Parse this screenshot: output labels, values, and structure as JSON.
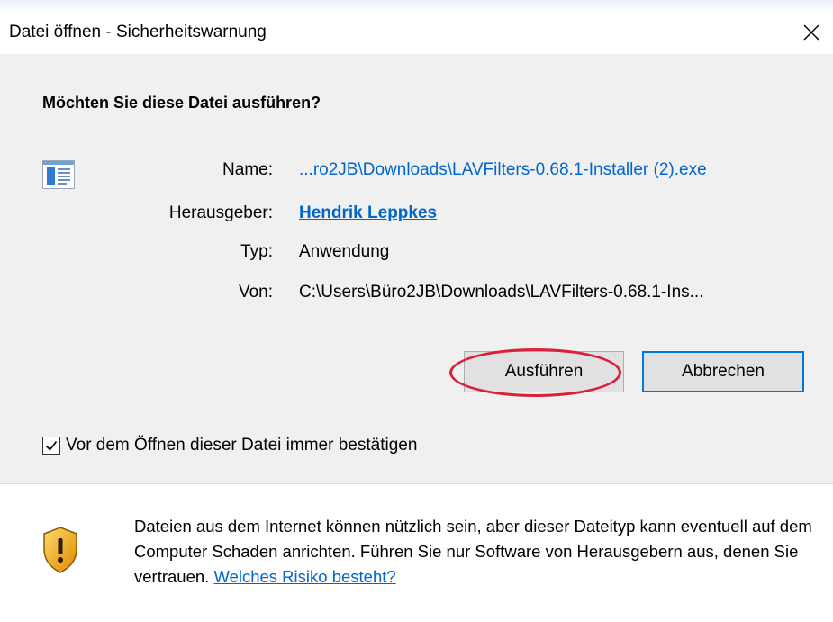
{
  "window": {
    "title": "Datei öffnen - Sicherheitswarnung",
    "close_glyph": "✕"
  },
  "prompt": {
    "question": "Möchten Sie diese Datei ausführen?"
  },
  "file_info": {
    "icon": "application-file-icon",
    "name_label": "Name:",
    "name_value": "...ro2JB\\Downloads\\LAVFilters-0.68.1-Installer (2).exe",
    "publisher_label": "Herausgeber:",
    "publisher_value": "Hendrik Leppkes",
    "type_label": "Typ:",
    "type_value": "Anwendung",
    "from_label": "Von:",
    "from_value": "C:\\Users\\Büro2JB\\Downloads\\LAVFilters-0.68.1-Ins..."
  },
  "buttons": {
    "run_label": "Ausführen",
    "cancel_label": "Abbrechen"
  },
  "checkbox": {
    "label": "Vor dem Öffnen dieser Datei immer bestätigen",
    "checked": true
  },
  "footer": {
    "icon": "shield-warning-icon",
    "warning_text": "Dateien aus dem Internet können nützlich sein, aber dieser Dateityp kann eventuell auf dem Computer Schaden anrichten. Führen Sie nur Software von Herausgebern aus, denen Sie vertrauen.",
    "risk_link": "Welches Risiko besteht?"
  },
  "colors": {
    "link": "#0066cc",
    "annotation": "#d8213a",
    "default_button_border": "#0078d7",
    "body_background": "#f0f0f0"
  }
}
